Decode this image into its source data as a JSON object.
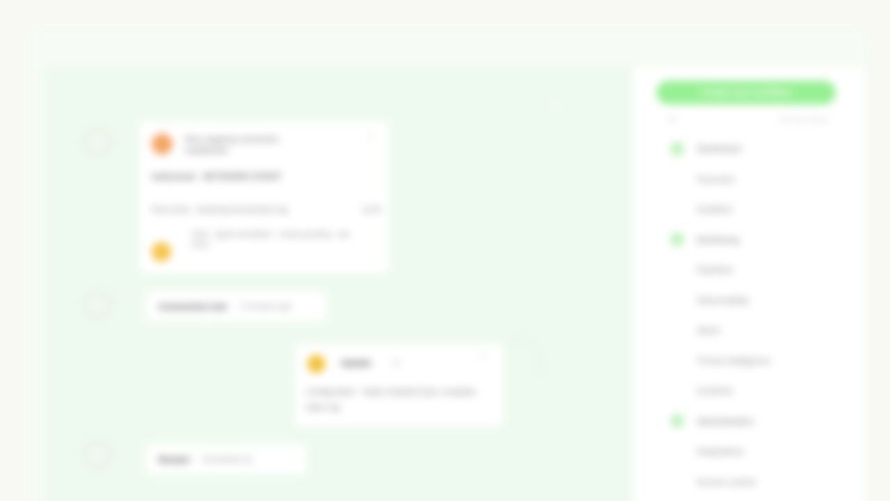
{
  "window": {
    "title": ""
  },
  "canvas": {
    "close_label": "×"
  },
  "feed": {
    "card1": {
      "title": "New outgoing connection established",
      "close_label": "×",
      "row1": "Authorized  ·  NETWORK EVENT",
      "row2_left": "Flow check  ·  streaming transmission log",
      "row2_right": "12:45",
      "annotation": "Note  ·  Agent annotation  ·  review pending  ·  see trace"
    },
    "pill2": {
      "bold": "Connection lost",
      "muted": "2 minutes ago"
    },
    "card2": {
      "title": "Update",
      "badge": "v2",
      "close_label": "×",
      "body": "Configuration · Node restarted  Sync complete · Open log"
    },
    "pill3": {
      "bold": "Restart",
      "muted": "Scheduled ok"
    }
  },
  "sidebar": {
    "primary_button": "Create new workflow",
    "filter_left": "All",
    "filter_right": "Sort by recent",
    "items": [
      {
        "label": "Dashboard",
        "group": true
      },
      {
        "label": "Overview",
        "group": false
      },
      {
        "label": "Analytics",
        "group": false
      },
      {
        "label": "Monitoring",
        "group": true
      },
      {
        "label": "Pipelines",
        "group": false
      },
      {
        "label": "Observability",
        "group": false
      },
      {
        "label": "Alerts",
        "group": false
      },
      {
        "label": "Threat intelligence",
        "group": false
      },
      {
        "label": "Incidents",
        "group": false
      },
      {
        "label": "Administration",
        "group": true
      },
      {
        "label": "Integrations",
        "group": false
      },
      {
        "label": "Access control",
        "group": false
      }
    ]
  },
  "colors": {
    "accent": "#98f095",
    "card_orange": "#f2a562",
    "card_yellow": "#f5c44a",
    "canvas_bg": "#eefaef"
  }
}
